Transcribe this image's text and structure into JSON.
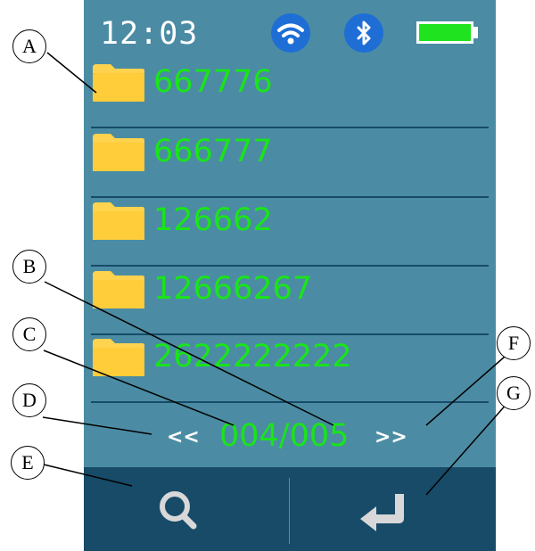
{
  "status": {
    "time": "12:03",
    "wifi_icon": "wifi-icon",
    "bluetooth_icon": "bluetooth-icon",
    "battery_icon": "battery-full-icon",
    "battery_level": 1.0
  },
  "folders": [
    {
      "name": "667776"
    },
    {
      "name": "666777"
    },
    {
      "name": "126662"
    },
    {
      "name": "12666267"
    },
    {
      "name": "2622222222"
    }
  ],
  "pager": {
    "prev": "<<",
    "page": "004/005",
    "next": ">>"
  },
  "toolbar": {
    "search_icon": "search-icon",
    "enter_icon": "enter-icon"
  },
  "callouts": [
    "A",
    "B",
    "C",
    "D",
    "E",
    "F",
    "G"
  ],
  "colors": {
    "screen_bg": "#4b8ca4",
    "toolbar_bg": "#174b68",
    "accent_text": "#19e519",
    "folder": "#ffc83a",
    "icon_circle": "#1e6ed6",
    "battery": "#1ee31e"
  }
}
